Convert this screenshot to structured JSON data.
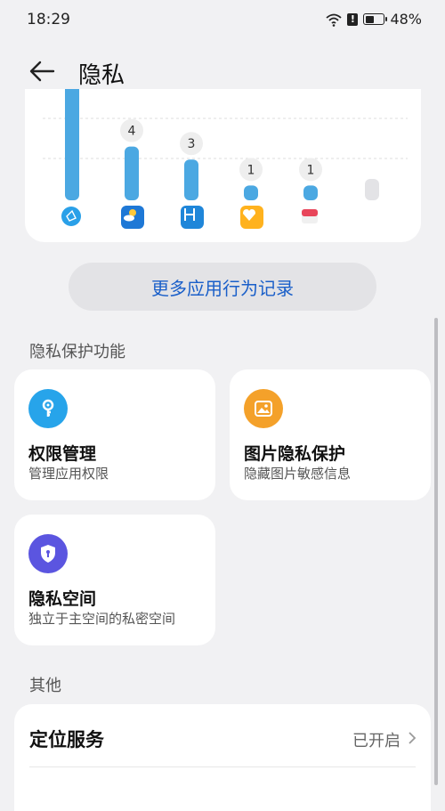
{
  "status_bar": {
    "time": "18:29",
    "battery": "48%",
    "battery_level": 0.48
  },
  "header": {
    "title": "隐私",
    "back_icon": "arrow-left-icon"
  },
  "chart_data": {
    "type": "bar",
    "categories": [
      "app-1",
      "app-2",
      "app-3",
      "app-4",
      "app-5",
      "app-6"
    ],
    "values": [
      null,
      4,
      3,
      1,
      1,
      0
    ],
    "value_labels": [
      "",
      "4",
      "3",
      "1",
      "1",
      ""
    ],
    "colors": {
      "bar": "#4ba8e2",
      "bar_empty": "#e3e3e6",
      "grid": "#dddddd",
      "bubble": "#eeeeee"
    },
    "grid": true
  },
  "chart_icons": [
    "network-icon",
    "weather-icon",
    "health-icon",
    "heart-app-icon",
    "calendar-icon"
  ],
  "more_button": {
    "label": "更多应用行为记录"
  },
  "privacy_section": {
    "label": "隐私保护功能",
    "features": [
      {
        "title": "权限管理",
        "subtitle": "管理应用权限",
        "icon": "key-icon",
        "color": "#27a4ea"
      },
      {
        "title": "图片隐私保护",
        "subtitle": "隐藏图片敏感信息",
        "icon": "image-icon",
        "color": "#f4a12a"
      },
      {
        "title": "隐私空间",
        "subtitle": "独立于主空间的私密空间",
        "icon": "shield-lock-icon",
        "color": "#5b55e0"
      }
    ]
  },
  "other_section": {
    "label": "其他",
    "items": [
      {
        "title": "定位服务",
        "value": "已开启"
      }
    ]
  }
}
